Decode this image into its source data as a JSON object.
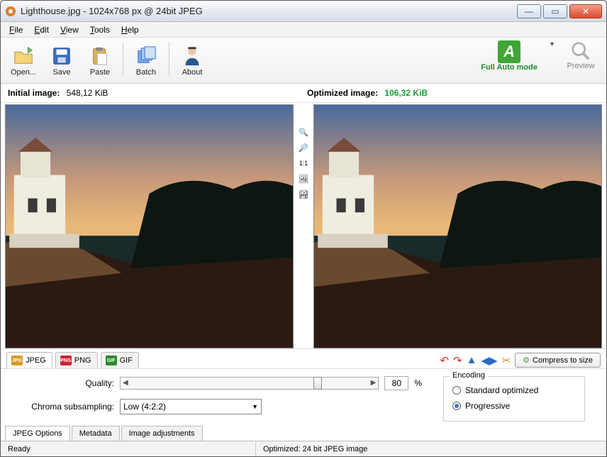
{
  "window": {
    "title": "Lighthouse.jpg - 1024x768 px @ 24bit JPEG"
  },
  "menubar": {
    "file": "File",
    "edit": "Edit",
    "view": "View",
    "tools": "Tools",
    "help": "Help"
  },
  "toolbar": {
    "open": "Open...",
    "save": "Save",
    "paste": "Paste",
    "batch": "Batch",
    "about": "About",
    "auto": "Full Auto mode",
    "preview": "Preview"
  },
  "info": {
    "initial_label": "Initial image:",
    "initial_size": "548,12 KiB",
    "optimized_label": "Optimized image:",
    "optimized_size": "106,32 KiB"
  },
  "midtools": {
    "ratio": "1:1"
  },
  "format_tabs": {
    "jpeg": "JPEG",
    "png": "PNG",
    "gif": "GIF"
  },
  "actions": {
    "compress": "Compress to size"
  },
  "options": {
    "quality_label": "Quality:",
    "quality_value": "80",
    "quality_pct": "%",
    "chroma_label": "Chroma subsampling:",
    "chroma_value": "Low (4:2:2)",
    "encoding_legend": "Encoding",
    "encoding_std": "Standard optimized",
    "encoding_prog": "Progressive"
  },
  "bottom_tabs": {
    "jpeg_opts": "JPEG Options",
    "metadata": "Metadata",
    "image_adj": "Image adjustments"
  },
  "status": {
    "ready": "Ready",
    "optimized": "Optimized: 24 bit JPEG image"
  }
}
